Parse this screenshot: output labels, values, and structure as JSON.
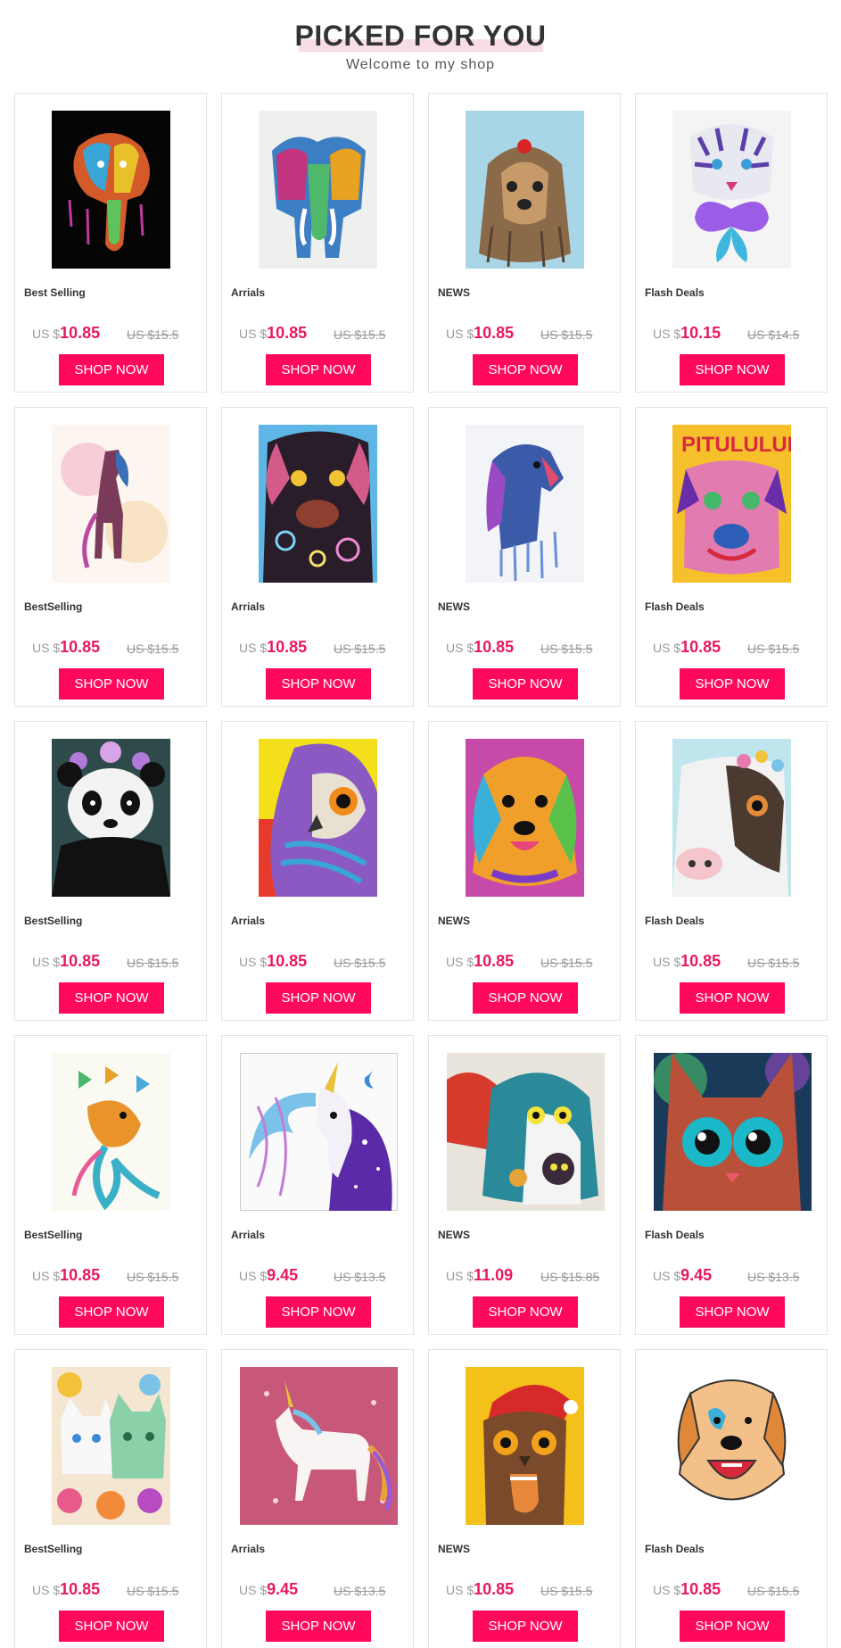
{
  "header": {
    "title": "PICKED FOR YOU",
    "subtitle": "Welcome to my shop"
  },
  "colors": {
    "accent": "#ff0a5a",
    "price": "#e8195f",
    "title_highlight": "#f9dde5"
  },
  "products": [
    {
      "label": "Best Selling",
      "currency": "US $",
      "price": "10.85",
      "old_price": "US $15.5",
      "button": "SHOP NOW",
      "image": "rainbow elephant on black"
    },
    {
      "label": "Arrials",
      "currency": "US $",
      "price": "10.85",
      "old_price": "US $15.5",
      "button": "SHOP NOW",
      "image": "colorful elephant with tusks"
    },
    {
      "label": "NEWS",
      "currency": "US $",
      "price": "10.85",
      "old_price": "US $15.5",
      "button": "SHOP NOW",
      "image": "yorkshire terrier"
    },
    {
      "label": "Flash Deals",
      "currency": "US $",
      "price": "10.15",
      "old_price": "US $14.5",
      "button": "SHOP NOW",
      "image": "tiger with butterfly"
    },
    {
      "label": "BestSelling",
      "currency": "US $",
      "price": "10.85",
      "old_price": "US $15.5",
      "button": "SHOP NOW",
      "image": "watercolor horse"
    },
    {
      "label": "Arrials",
      "currency": "US $",
      "price": "10.85",
      "old_price": "US $15.5",
      "button": "SHOP NOW",
      "image": "patterned dog on blue"
    },
    {
      "label": "NEWS",
      "currency": "US $",
      "price": "10.85",
      "old_price": "US $15.5",
      "button": "SHOP NOW",
      "image": "dripping paint horse"
    },
    {
      "label": "Flash Deals",
      "currency": "US $",
      "price": "10.85",
      "old_price": "US $15.5",
      "button": "SHOP NOW",
      "image": "psychedelic pit bull"
    },
    {
      "label": "BestSelling",
      "currency": "US $",
      "price": "10.85",
      "old_price": "US $15.5",
      "button": "SHOP NOW",
      "image": "panda with flower crown"
    },
    {
      "label": "Arrials",
      "currency": "US $",
      "price": "10.85",
      "old_price": "US $15.5",
      "button": "SHOP NOW",
      "image": "colorful owl"
    },
    {
      "label": "NEWS",
      "currency": "US $",
      "price": "10.85",
      "old_price": "US $15.5",
      "button": "SHOP NOW",
      "image": "rainbow golden retriever"
    },
    {
      "label": "Flash Deals",
      "currency": "US $",
      "price": "10.85",
      "old_price": "US $15.5",
      "button": "SHOP NOW",
      "image": "floral cow"
    },
    {
      "label": "BestSelling",
      "currency": "US $",
      "price": "10.85",
      "old_price": "US $15.5",
      "button": "SHOP NOW",
      "image": "butterflies and bird"
    },
    {
      "label": "Arrials",
      "currency": "US $",
      "price": "9.45",
      "old_price": "US $13.5",
      "button": "SHOP NOW",
      "image": "galaxy unicorn"
    },
    {
      "label": "NEWS",
      "currency": "US $",
      "price": "11.09",
      "old_price": "US $15.85",
      "button": "SHOP NOW",
      "image": "fluffy cats"
    },
    {
      "label": "Flash Deals",
      "currency": "US $",
      "price": "9.45",
      "old_price": "US $13.5",
      "button": "SHOP NOW",
      "image": "big eyed cat"
    },
    {
      "label": "BestSelling",
      "currency": "US $",
      "price": "10.85",
      "old_price": "US $15.5",
      "button": "SHOP NOW",
      "image": "patterned cats with flowers"
    },
    {
      "label": "Arrials",
      "currency": "US $",
      "price": "9.45",
      "old_price": "US $13.5",
      "button": "SHOP NOW",
      "image": "white unicorn on pink"
    },
    {
      "label": "NEWS",
      "currency": "US $",
      "price": "10.85",
      "old_price": "US $15.5",
      "button": "SHOP NOW",
      "image": "christmas owl with stocking"
    },
    {
      "label": "Flash Deals",
      "currency": "US $",
      "price": "10.85",
      "old_price": "US $15.5",
      "button": "SHOP NOW",
      "image": "sketch happy dog"
    }
  ]
}
